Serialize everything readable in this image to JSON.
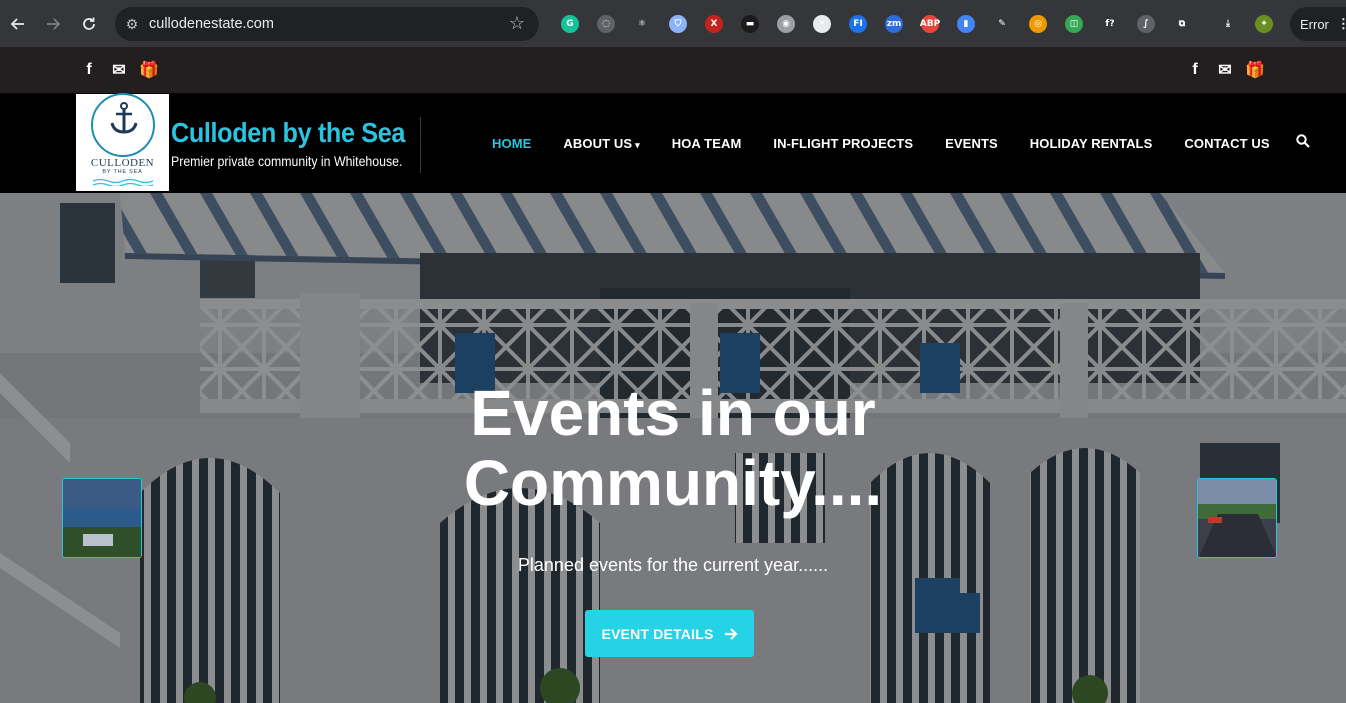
{
  "browser": {
    "url": "cullodenestate.com",
    "error_label": "Error",
    "extensions": [
      {
        "name": "grammarly-icon",
        "glyph": "G",
        "color": "#15c39a"
      },
      {
        "name": "sync-icon",
        "glyph": "◌",
        "color": "#5f6368"
      },
      {
        "name": "react-devtools-icon",
        "glyph": "⚛",
        "color": "#35363a"
      },
      {
        "name": "shield-icon",
        "glyph": "⛉",
        "color": "#8ab4f8"
      },
      {
        "name": "x-extension-icon",
        "glyph": "X",
        "color": "#c5221f"
      },
      {
        "name": "dark-extension-icon",
        "glyph": "▬",
        "color": "#1b1b1b"
      },
      {
        "name": "camera-icon",
        "glyph": "◉",
        "color": "#9aa0a6"
      },
      {
        "name": "ghost-icon",
        "glyph": "•",
        "color": "#e8eaed"
      },
      {
        "name": "fi-extension-icon",
        "glyph": "FI",
        "color": "#1a73e8"
      },
      {
        "name": "zoom-extension-icon",
        "glyph": "zm",
        "color": "#2d6cdf"
      },
      {
        "name": "adblock-icon",
        "glyph": "ABP",
        "color": "#e8453c"
      },
      {
        "name": "docs-icon",
        "glyph": "▮",
        "color": "#4285f4"
      },
      {
        "name": "eyedropper-icon",
        "glyph": "✎",
        "color": "#35363a"
      },
      {
        "name": "orange-extension-icon",
        "glyph": "◎",
        "color": "#f29900"
      },
      {
        "name": "wappalyzer-icon",
        "glyph": "◫",
        "color": "#34a853"
      },
      {
        "name": "font-extension-icon",
        "glyph": "f?",
        "color": "#35363a"
      },
      {
        "name": "script-extension-icon",
        "glyph": "∫",
        "color": "#5f6368"
      },
      {
        "name": "puzzle-icon",
        "glyph": "⧉",
        "color": "#35363a"
      },
      {
        "name": "download-icon",
        "glyph": "⤓",
        "color": "#35363a"
      },
      {
        "name": "profile-avatar-icon",
        "glyph": "✦",
        "color": "#6b8e23"
      }
    ]
  },
  "social": {
    "left": [
      {
        "name": "facebook-icon",
        "glyph": "f"
      },
      {
        "name": "email-icon",
        "glyph": "✉"
      },
      {
        "name": "gift-icon",
        "glyph": "🎁"
      }
    ],
    "right": [
      {
        "name": "facebook-icon",
        "glyph": "f"
      },
      {
        "name": "email-icon",
        "glyph": "✉"
      },
      {
        "name": "gift-icon",
        "glyph": "🎁"
      }
    ]
  },
  "brand": {
    "logo_word": "CULLODEN",
    "logo_sub": "BY THE SEA",
    "title": "Culloden by the Sea",
    "tagline": "Premier private community in Whitehouse."
  },
  "nav": {
    "items": [
      {
        "label": "HOME",
        "active": true,
        "dropdown": false
      },
      {
        "label": "ABOUT US",
        "active": false,
        "dropdown": true
      },
      {
        "label": "HOA TEAM",
        "active": false,
        "dropdown": false
      },
      {
        "label": "IN-FLIGHT PROJECTS",
        "active": false,
        "dropdown": false
      },
      {
        "label": "EVENTS",
        "active": false,
        "dropdown": false
      },
      {
        "label": "HOLIDAY RENTALS",
        "active": false,
        "dropdown": false
      },
      {
        "label": "CONTACT US",
        "active": false,
        "dropdown": false
      }
    ]
  },
  "hero": {
    "title_line1": "Events in our",
    "title_line2": "Community....",
    "subtitle": "Planned events for the current year......",
    "button_label": "EVENT DETAILS"
  },
  "colors": {
    "accent": "#2bc4e0",
    "button": "#26d2e6",
    "header_bg": "#000000",
    "social_bar_bg": "#231f20"
  }
}
